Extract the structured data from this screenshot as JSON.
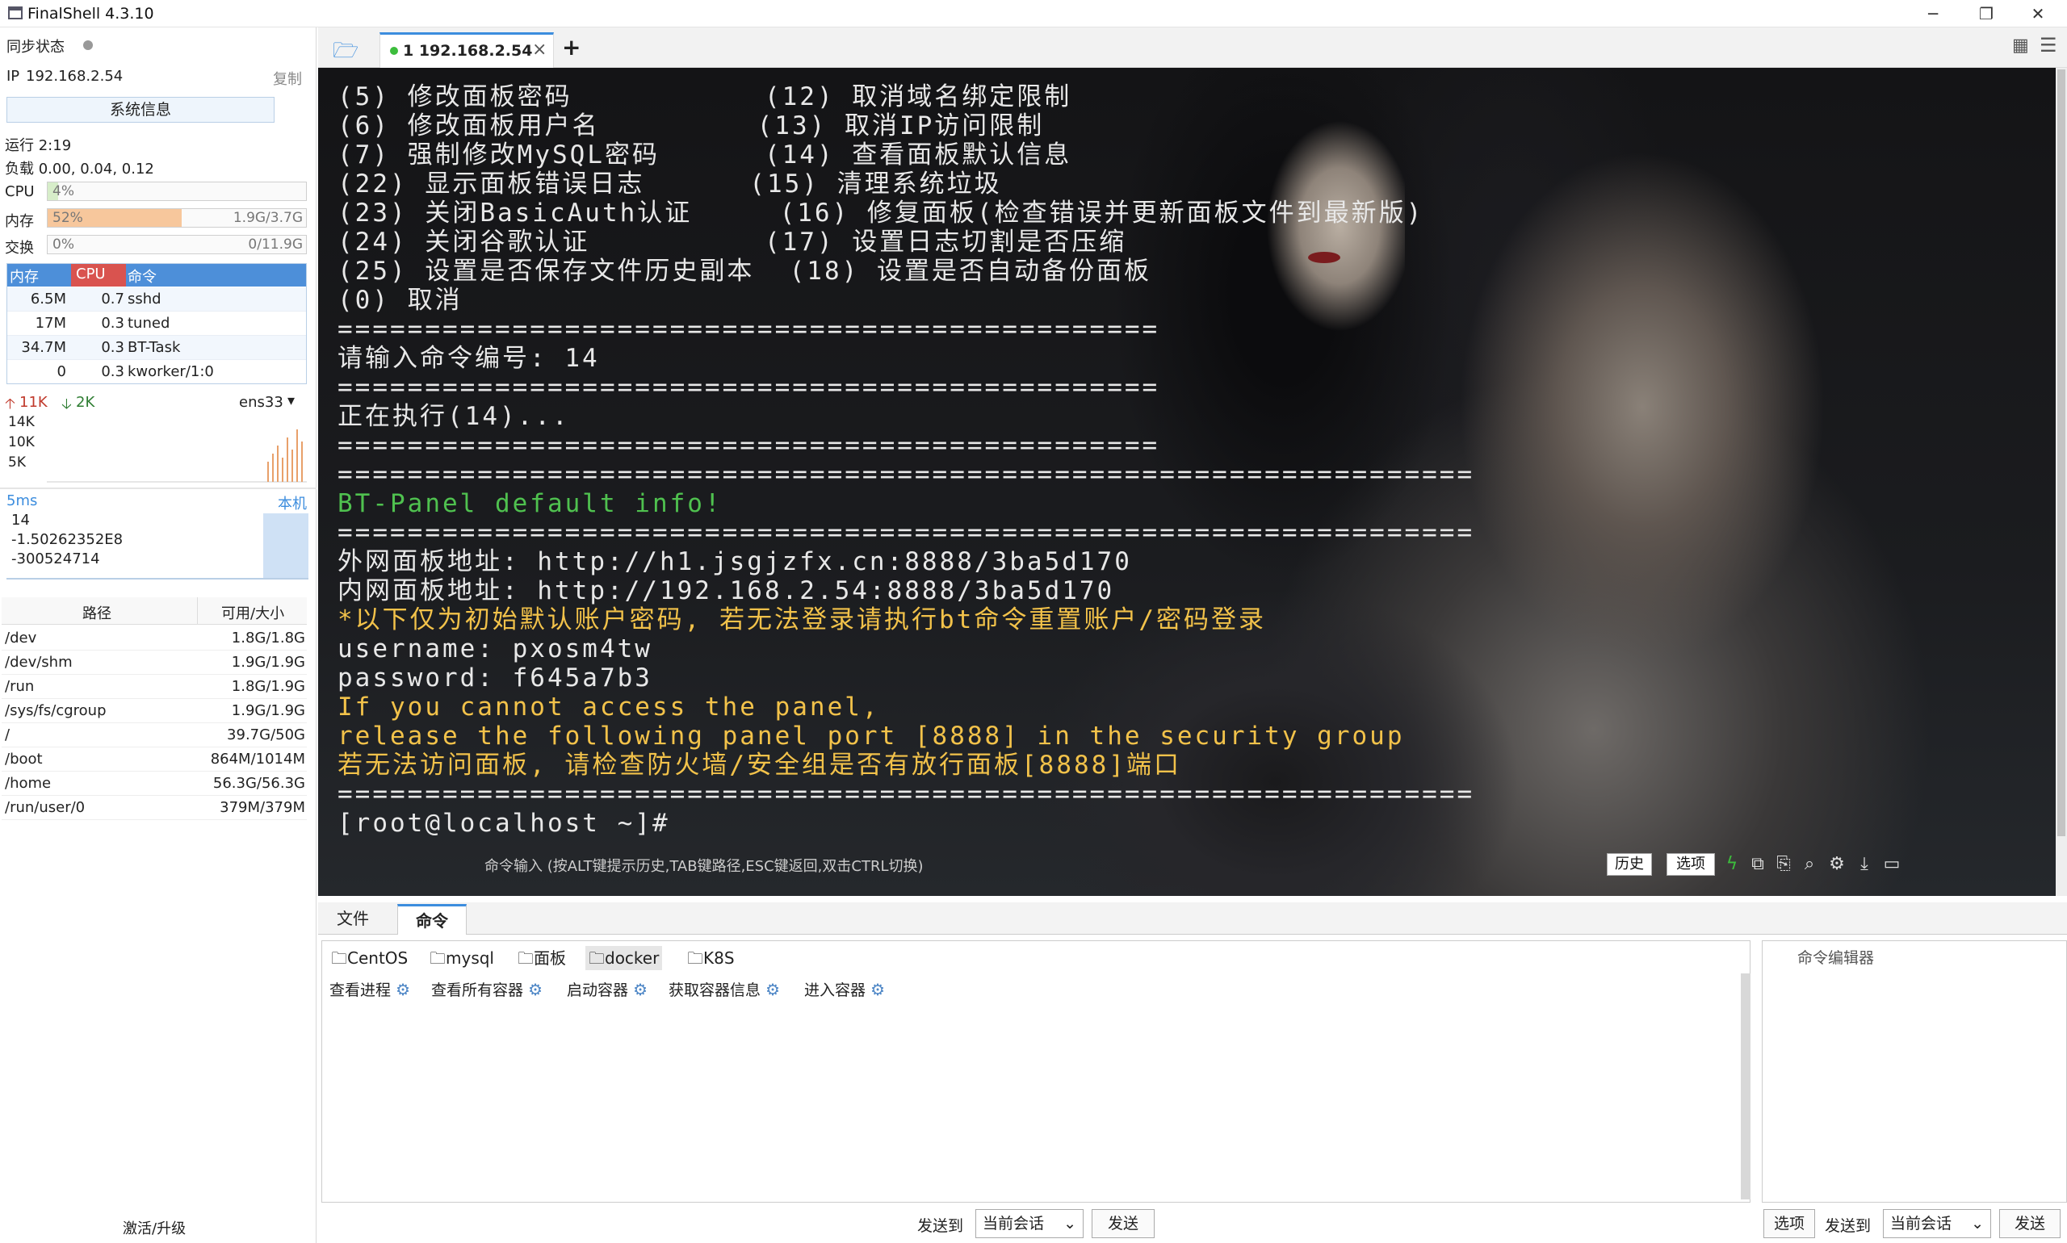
{
  "app": {
    "title": "FinalShell 4.3.10"
  },
  "window": {
    "minimize": "─",
    "maximize": "❐",
    "close": "✕"
  },
  "sidebar": {
    "sync_label": "同步状态",
    "ip_label": "IP",
    "ip": "192.168.2.54",
    "copy": "复制",
    "sysinfo_button": "系统信息",
    "uptime": "运行 2:19",
    "load": "负载 0.00, 0.04, 0.12",
    "cpu": {
      "label": "CPU",
      "value": "4%",
      "fraction": 0.04
    },
    "mem": {
      "label": "内存",
      "value": "52%",
      "detail": "1.9G/3.7G",
      "fraction": 0.52
    },
    "swap": {
      "label": "交换",
      "value": "0%",
      "detail": "0/11.9G",
      "fraction": 0
    },
    "proc_headers": [
      "内存",
      "CPU",
      "命令"
    ],
    "processes": [
      {
        "mem": "6.5M",
        "cpu": "0.7",
        "cmd": "sshd"
      },
      {
        "mem": "17M",
        "cpu": "0.3",
        "cmd": "tuned"
      },
      {
        "mem": "34.7M",
        "cpu": "0.3",
        "cmd": "BT-Task"
      },
      {
        "mem": "0",
        "cpu": "0.3",
        "cmd": "kworker/1:0"
      }
    ],
    "net": {
      "up": "11K",
      "down": "2K",
      "iface": "ens33",
      "ticks": [
        "14K",
        "10K",
        "5K"
      ]
    },
    "latency": {
      "label": "5ms",
      "host": "本机",
      "values": [
        "14",
        "-1.50262352E8",
        "-300524714"
      ]
    },
    "fs_headers": [
      "路径",
      "可用/大小"
    ],
    "filesystems": [
      {
        "path": "/dev",
        "size": "1.8G/1.8G"
      },
      {
        "path": "/dev/shm",
        "size": "1.9G/1.9G"
      },
      {
        "path": "/run",
        "size": "1.8G/1.9G"
      },
      {
        "path": "/sys/fs/cgroup",
        "size": "1.9G/1.9G"
      },
      {
        "path": "/",
        "size": "39.7G/50G"
      },
      {
        "path": "/boot",
        "size": "864M/1014M"
      },
      {
        "path": "/home",
        "size": "56.3G/56.3G"
      },
      {
        "path": "/run/user/0",
        "size": "379M/379M"
      }
    ],
    "activate": "激活/升级"
  },
  "tabs": {
    "session": "1 192.168.2.54",
    "close": "×",
    "add": "+"
  },
  "terminal": {
    "lines": [
      "(5) 修改面板密码           (12) 取消域名绑定限制",
      "(6) 修改面板用户名         (13) 取消IP访问限制",
      "(7) 强制修改MySQL密码      (14) 查看面板默认信息",
      "(22) 显示面板错误日志      (15) 清理系统垃圾",
      "(23) 关闭BasicAuth认证     (16) 修复面板(检查错误并更新面板文件到最新版)",
      "(24) 关闭谷歌认证          (17) 设置日志切割是否压缩",
      "(25) 设置是否保存文件历史副本  (18) 设置是否自动备份面板",
      "(0) 取消",
      "===============================================",
      "请输入命令编号: 14",
      "===============================================",
      "正在执行(14)...",
      "===============================================",
      "=================================================================",
      "BT-Panel default info!",
      "=================================================================",
      "外网面板地址: http://h1.jsgjzfx.cn:8888/3ba5d170",
      "内网面板地址: http://192.168.2.54:8888/3ba5d170",
      "*以下仅为初始默认账户密码, 若无法登录请执行bt命令重置账户/密码登录",
      "username: pxosm4tw",
      "password: f645a7b3",
      "If you cannot access the panel,",
      "release the following panel port [8888] in the security group",
      "若无法访问面板, 请检查防火墙/安全组是否有放行面板[8888]端口",
      "=================================================================",
      "[root@localhost ~]#"
    ],
    "input_hint": "命令输入 (按ALT键提示历史,TAB键路径,ESC键返回,双击CTRL切换)",
    "history_btn": "历史",
    "options_btn": "选项"
  },
  "bottom": {
    "tabs": [
      "文件",
      "命令"
    ],
    "folders": [
      "CentOS",
      "mysql",
      "面板",
      "docker",
      "K8S"
    ],
    "commands": [
      "查看进程",
      "查看所有容器",
      "启动容器",
      "获取容器信息",
      "进入容器"
    ],
    "editor_title": "命令编辑器",
    "send_to": "发送到",
    "target": "当前会话",
    "send": "发送",
    "options": "选项"
  },
  "colors": {
    "accent": "#3c8dde",
    "mem_fill": "#f7c79c",
    "cpu_fill": "#d7edc9",
    "warn": "#f2c24a",
    "ok": "#4fc14f"
  }
}
